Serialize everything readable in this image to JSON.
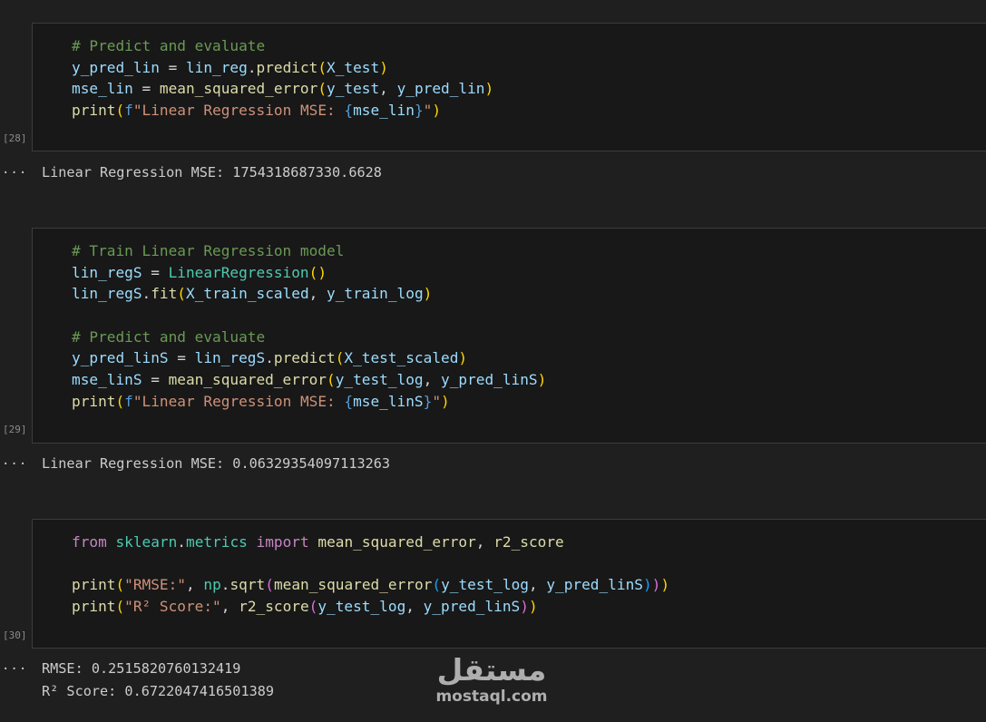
{
  "cells": [
    {
      "exec_count": "[28]",
      "lines": [
        [
          [
            "comment",
            "# Predict and evaluate"
          ]
        ],
        [
          [
            "var",
            "y_pred_lin"
          ],
          [
            "plain",
            " = "
          ],
          [
            "var",
            "lin_reg"
          ],
          [
            "plain",
            "."
          ],
          [
            "fn",
            "predict"
          ],
          [
            "p1",
            "("
          ],
          [
            "var",
            "X_test"
          ],
          [
            "p1",
            ")"
          ]
        ],
        [
          [
            "var",
            "mse_lin"
          ],
          [
            "plain",
            " = "
          ],
          [
            "fn",
            "mean_squared_error"
          ],
          [
            "p1",
            "("
          ],
          [
            "var",
            "y_test"
          ],
          [
            "plain",
            ", "
          ],
          [
            "var",
            "y_pred_lin"
          ],
          [
            "p1",
            ")"
          ]
        ],
        [
          [
            "fn",
            "print"
          ],
          [
            "p1",
            "("
          ],
          [
            "fkw",
            "f"
          ],
          [
            "str",
            "\"Linear Regression MSE: "
          ],
          [
            "fkw",
            "{"
          ],
          [
            "var",
            "mse_lin"
          ],
          [
            "fkw",
            "}"
          ],
          [
            "str",
            "\""
          ],
          [
            "p1",
            ")"
          ]
        ]
      ],
      "output": [
        "Linear Regression MSE: 1754318687330.6628"
      ]
    },
    {
      "exec_count": "[29]",
      "lines": [
        [
          [
            "comment",
            "# Train Linear Regression model"
          ]
        ],
        [
          [
            "var",
            "lin_regS"
          ],
          [
            "plain",
            " = "
          ],
          [
            "cls",
            "LinearRegression"
          ],
          [
            "p1",
            "()"
          ]
        ],
        [
          [
            "var",
            "lin_regS"
          ],
          [
            "plain",
            "."
          ],
          [
            "fn",
            "fit"
          ],
          [
            "p1",
            "("
          ],
          [
            "var",
            "X_train_scaled"
          ],
          [
            "plain",
            ", "
          ],
          [
            "var",
            "y_train_log"
          ],
          [
            "p1",
            ")"
          ]
        ],
        [],
        [
          [
            "comment",
            "# Predict and evaluate"
          ]
        ],
        [
          [
            "var",
            "y_pred_linS"
          ],
          [
            "plain",
            " = "
          ],
          [
            "var",
            "lin_regS"
          ],
          [
            "plain",
            "."
          ],
          [
            "fn",
            "predict"
          ],
          [
            "p1",
            "("
          ],
          [
            "var",
            "X_test_scaled"
          ],
          [
            "p1",
            ")"
          ]
        ],
        [
          [
            "var",
            "mse_linS"
          ],
          [
            "plain",
            " = "
          ],
          [
            "fn",
            "mean_squared_error"
          ],
          [
            "p1",
            "("
          ],
          [
            "var",
            "y_test_log"
          ],
          [
            "plain",
            ", "
          ],
          [
            "var",
            "y_pred_linS"
          ],
          [
            "p1",
            ")"
          ]
        ],
        [
          [
            "fn",
            "print"
          ],
          [
            "p1",
            "("
          ],
          [
            "fkw",
            "f"
          ],
          [
            "str",
            "\"Linear Regression MSE: "
          ],
          [
            "fkw",
            "{"
          ],
          [
            "var",
            "mse_linS"
          ],
          [
            "fkw",
            "}"
          ],
          [
            "str",
            "\""
          ],
          [
            "p1",
            ")"
          ]
        ]
      ],
      "output": [
        "Linear Regression MSE: 0.06329354097113263"
      ]
    },
    {
      "exec_count": "[30]",
      "lines": [
        [
          [
            "kw",
            "from"
          ],
          [
            "plain",
            " "
          ],
          [
            "cls",
            "sklearn"
          ],
          [
            "plain",
            "."
          ],
          [
            "cls",
            "metrics"
          ],
          [
            "plain",
            " "
          ],
          [
            "kw",
            "import"
          ],
          [
            "plain",
            " "
          ],
          [
            "fn",
            "mean_squared_error"
          ],
          [
            "plain",
            ", "
          ],
          [
            "fn",
            "r2_score"
          ]
        ],
        [],
        [
          [
            "fn",
            "print"
          ],
          [
            "p1",
            "("
          ],
          [
            "str",
            "\"RMSE:\""
          ],
          [
            "plain",
            ", "
          ],
          [
            "cls",
            "np"
          ],
          [
            "plain",
            "."
          ],
          [
            "fn",
            "sqrt"
          ],
          [
            "p2",
            "("
          ],
          [
            "fn",
            "mean_squared_error"
          ],
          [
            "p3",
            "("
          ],
          [
            "var",
            "y_test_log"
          ],
          [
            "plain",
            ", "
          ],
          [
            "var",
            "y_pred_linS"
          ],
          [
            "p3",
            ")"
          ],
          [
            "p2",
            ")"
          ],
          [
            "p1",
            ")"
          ]
        ],
        [
          [
            "fn",
            "print"
          ],
          [
            "p1",
            "("
          ],
          [
            "str",
            "\"R² Score:\""
          ],
          [
            "plain",
            ", "
          ],
          [
            "fn",
            "r2_score"
          ],
          [
            "p2",
            "("
          ],
          [
            "var",
            "y_test_log"
          ],
          [
            "plain",
            ", "
          ],
          [
            "var",
            "y_pred_linS"
          ],
          [
            "p2",
            ")"
          ],
          [
            "p1",
            ")"
          ]
        ]
      ],
      "output": [
        "RMSE: 0.2515820760132419",
        "R² Score: 0.6722047416501389"
      ]
    }
  ],
  "output_marker": "...",
  "watermark": {
    "arabic": "مستقل",
    "latin": "mostaql.com"
  },
  "colors": {
    "comment": "#6a9955",
    "variable": "#9cdcfe",
    "function": "#dcdcaa",
    "class": "#4ec9b0",
    "string": "#ce9178",
    "keyword": "#c586c0",
    "bracket": "#ffd700"
  }
}
